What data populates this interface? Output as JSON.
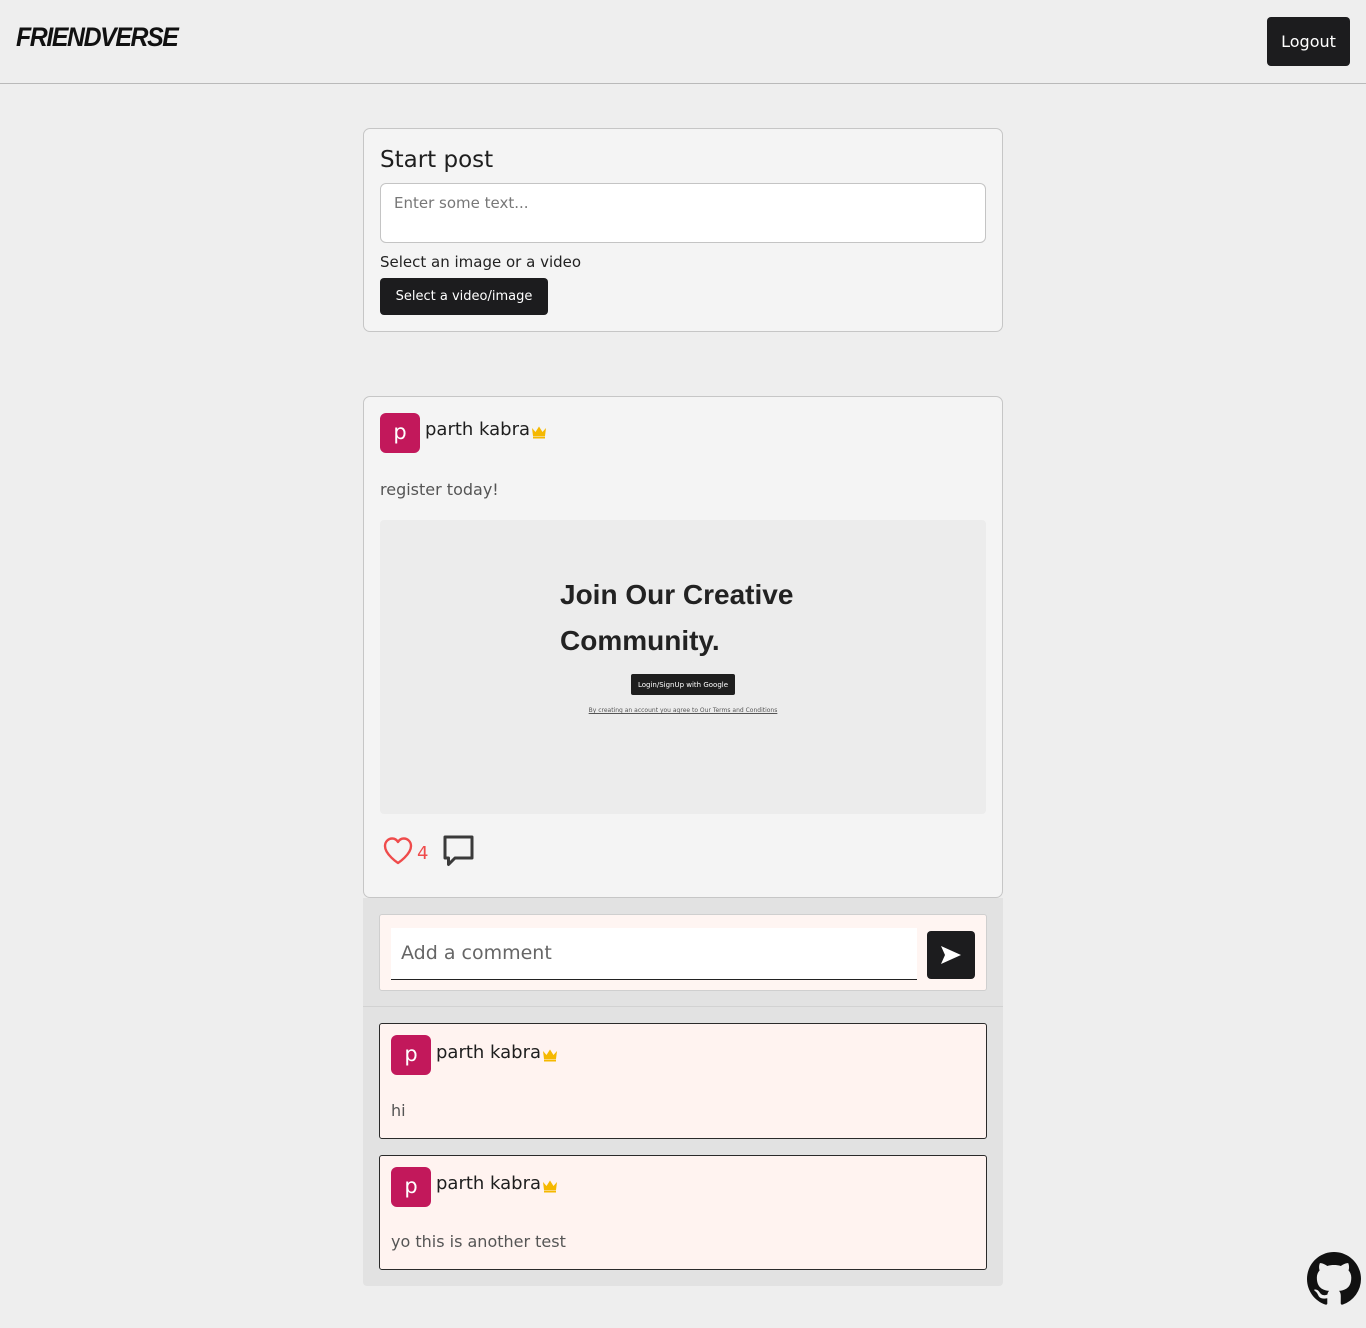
{
  "app": {
    "logo": "FRIENDVERSE",
    "logout_label": "Logout"
  },
  "composer": {
    "title": "Start post",
    "placeholder": "Enter some text...",
    "media_label": "Select an image or a video",
    "select_button": "Select a video/image"
  },
  "post": {
    "author_initial": "p",
    "author_name": "parth kabra",
    "author_badge": "crown-icon",
    "text": "register today!",
    "media": {
      "heading": "Join Our Creative Community.",
      "button": "Login/SignUp with Google",
      "terms": "By creating an account you agree to Our Terms and Conditions"
    },
    "likes": "4",
    "like_color": "#ef4b4b"
  },
  "comment_form": {
    "placeholder": "Add a comment",
    "send_icon": "send-icon"
  },
  "comments": [
    {
      "initial": "p",
      "name": "parth kabra",
      "text": "hi"
    },
    {
      "initial": "p",
      "name": "parth kabra",
      "text": "yo this is another test"
    }
  ],
  "footer": {
    "icon": "github-icon"
  },
  "colors": {
    "avatar": "#c2185b",
    "crown": "#f5b800",
    "dark_button": "#1c1c1e",
    "comment_bg": "#fff3f0"
  }
}
